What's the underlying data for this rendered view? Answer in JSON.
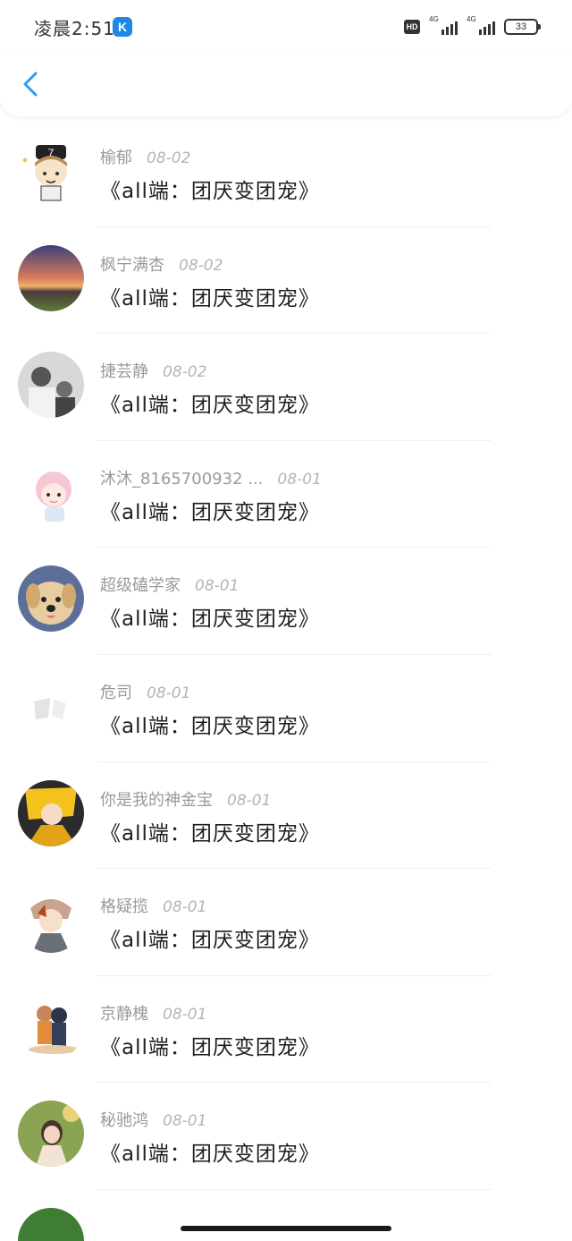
{
  "status_bar": {
    "time": "凌晨2:51",
    "app_badge": "K",
    "hd": "HD",
    "network_1": "4G",
    "network_2": "4G",
    "battery": "33"
  },
  "nav": {
    "back_icon": "chevron-left-icon",
    "accent": "#2a9df4"
  },
  "items": [
    {
      "name": "榆郁",
      "date": "08-02",
      "message": "《all端：团厌变团宠》"
    },
    {
      "name": "枫宁满杏",
      "date": "08-02",
      "message": "《all端：团厌变团宠》"
    },
    {
      "name": "捷芸静",
      "date": "08-02",
      "message": "《all端：团厌变团宠》"
    },
    {
      "name": "沐沐_8165700932 ...",
      "date": "08-01",
      "message": "《all端：团厌变团宠》"
    },
    {
      "name": "超级磕学家",
      "date": "08-01",
      "message": "《all端：团厌变团宠》"
    },
    {
      "name": "危司",
      "date": "08-01",
      "message": "《all端：团厌变团宠》"
    },
    {
      "name": "你是我的神金宝",
      "date": "08-01",
      "message": "《all端：团厌变团宠》"
    },
    {
      "name": "格疑揽",
      "date": "08-01",
      "message": "《all端：团厌变团宠》"
    },
    {
      "name": "京静槐",
      "date": "08-01",
      "message": "《all端：团厌变团宠》"
    },
    {
      "name": "秘驰鸿",
      "date": "08-01",
      "message": "《all端：团厌变团宠》"
    }
  ]
}
